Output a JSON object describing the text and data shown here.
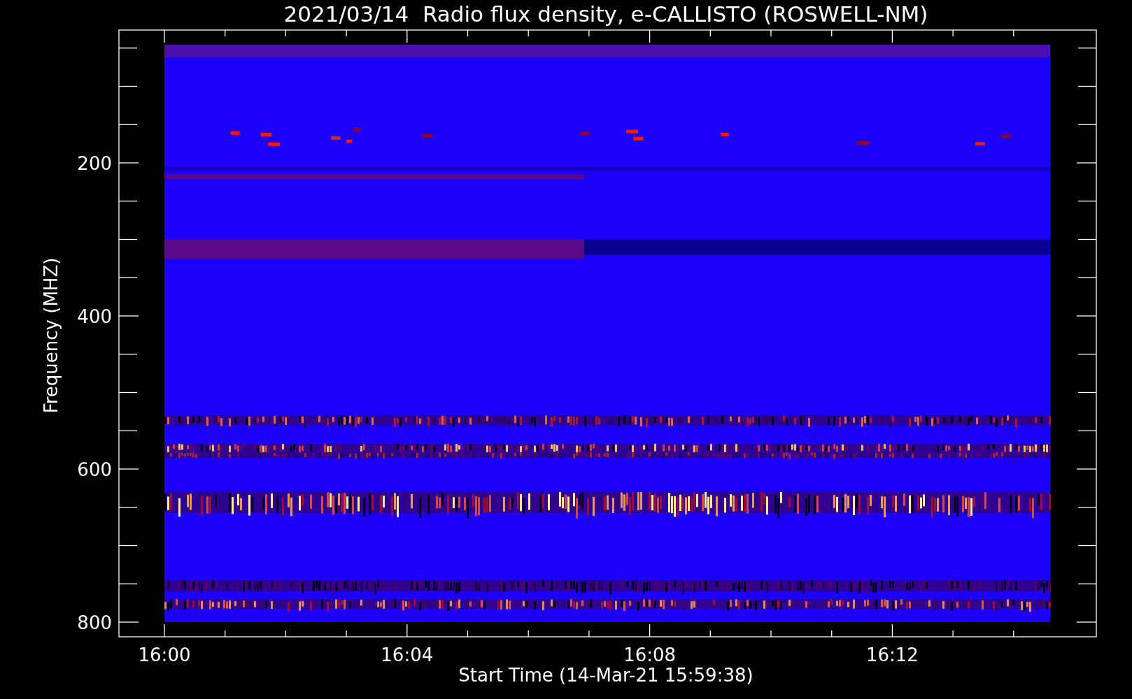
{
  "plot": {
    "title": "2021/03/14  Radio flux density, e-CALLISTO (ROSWELL-NM)",
    "ylabel": "Frequency (MHZ)",
    "xlabel": "Start Time (14-Mar-21 15:59:38)",
    "yticks": [
      "200",
      "400",
      "600",
      "800"
    ],
    "xticks": [
      "16:00",
      "16:04",
      "16:08",
      "16:12"
    ]
  }
}
